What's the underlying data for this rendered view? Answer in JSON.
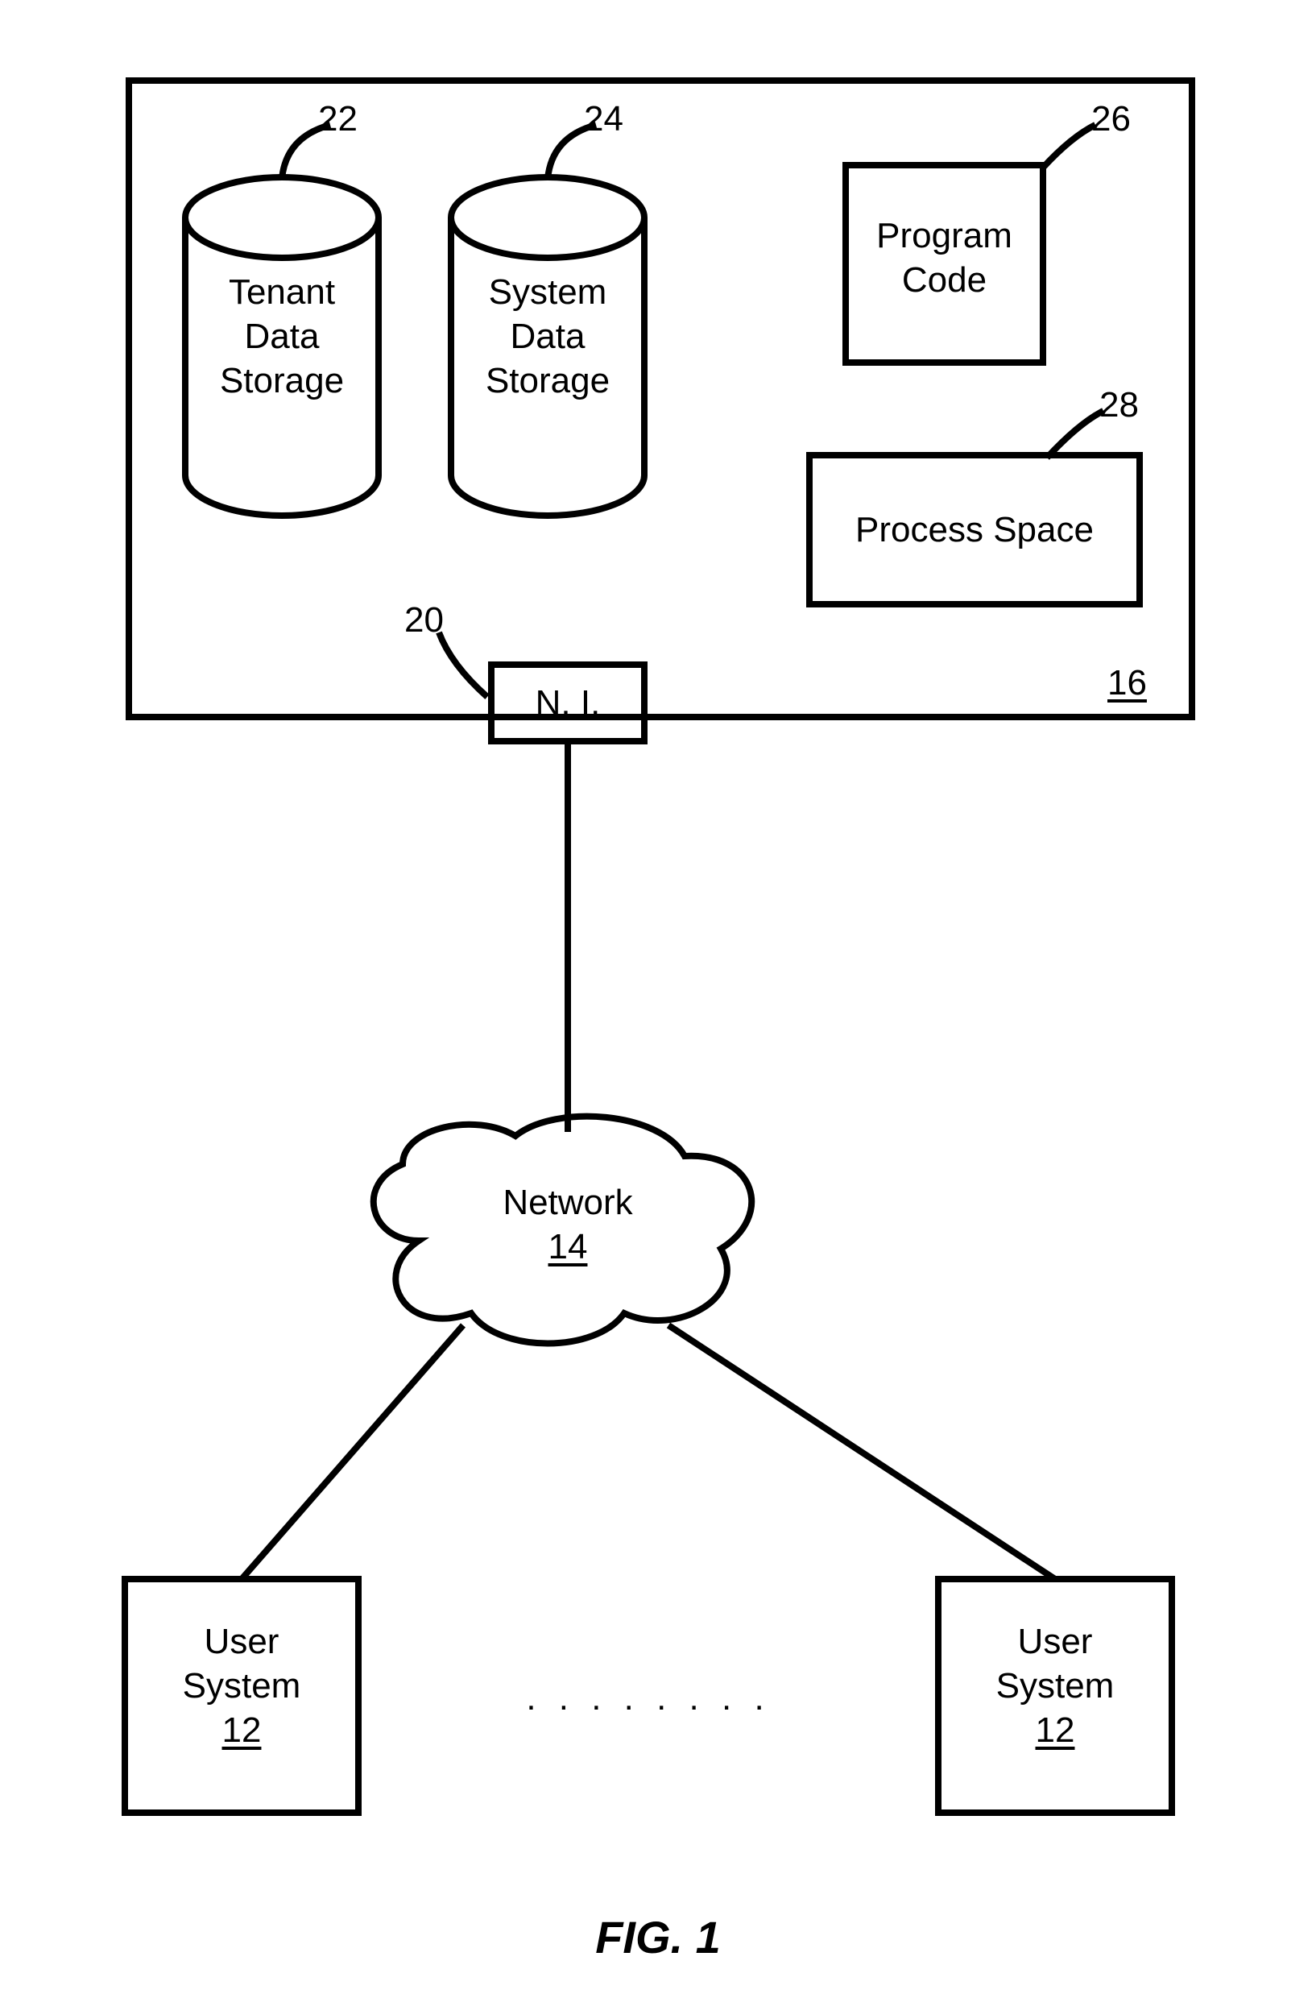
{
  "figure_caption": "FIG. 1",
  "server_box_ref": "16",
  "tenant_storage": {
    "ref": "22",
    "line1": "Tenant",
    "line2": "Data",
    "line3": "Storage"
  },
  "system_storage": {
    "ref": "24",
    "line1": "System",
    "line2": "Data",
    "line3": "Storage"
  },
  "program_code": {
    "ref": "26",
    "label": "Program",
    "label2": "Code"
  },
  "process_space": {
    "ref": "28",
    "label": "Process Space"
  },
  "network_interface": {
    "ref": "20",
    "label": "N. I."
  },
  "network": {
    "ref": "14",
    "label": "Network"
  },
  "user_system_left": {
    "ref": "12",
    "label": "User",
    "label2": "System"
  },
  "user_system_right": {
    "ref": "12",
    "label": "User",
    "label2": "System"
  },
  "ellipsis": ". . . . . . . ."
}
